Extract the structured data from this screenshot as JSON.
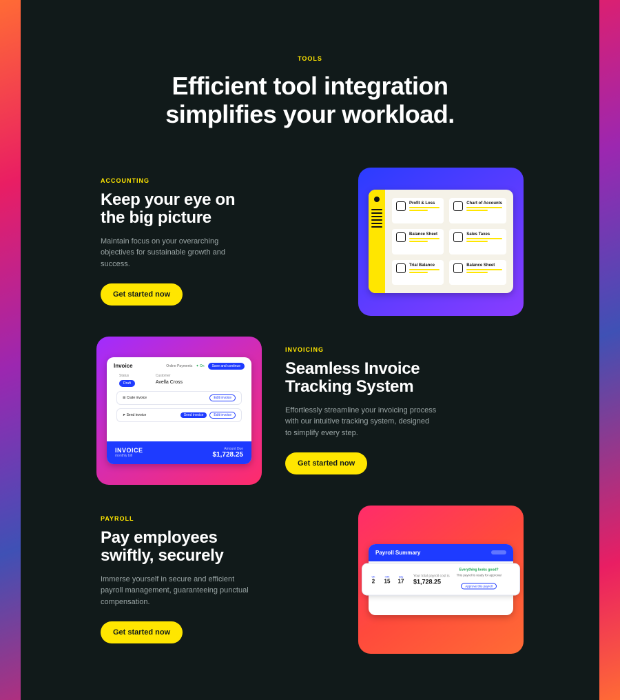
{
  "header": {
    "eyebrow": "TOOLS",
    "headline_line1": "Efficient tool integration",
    "headline_line2": "simplifies your workload."
  },
  "cta_label": "Get started now",
  "tool1": {
    "category": "ACCOUNTING",
    "title_line1": "Keep your eye on",
    "title_line2": "the big picture",
    "description": "Maintain focus on your overarching objectives for sustainable growth and success.",
    "cards": [
      "Profit & Loss",
      "Chart of Accounts",
      "Balance Sheet",
      "Sales Taxes",
      "Trial Balance",
      "Balance Sheet"
    ]
  },
  "tool2": {
    "category": "INVOICING",
    "title_line1": "Seamless Invoice",
    "title_line2": "Tracking System",
    "description": "Effortlessly streamline your invoicing process with our intuitive tracking system, designed to simplify every step.",
    "invoice": {
      "title": "Invoice",
      "online_payments": "Online Payments",
      "online_status": "✦ On",
      "save_btn": "Save and continue",
      "status_label": "Status",
      "status_value": "Draft",
      "customer_label": "Customer",
      "customer_value": "Avella Cross",
      "row1": "Crate invoice",
      "row2": "Send invoice",
      "edit_btn": "Edit invoice",
      "send_btn": "Send invoice",
      "banner_title": "INVOICE",
      "banner_sub": "monthly bill",
      "banner_amount_label": "Amount Due",
      "banner_amount": "$1,728.25"
    }
  },
  "tool3": {
    "category": "PAYROLL",
    "title_line1": "Pay employees",
    "title_line2": "swiftly, securely",
    "description": "Immerse yourself in secure and efficient payroll management, guaranteeing punctual compensation.",
    "payroll": {
      "header": "Payroll Summary",
      "date_labels": [
        "wk",
        "mth",
        "day"
      ],
      "date_values": [
        "2",
        "15",
        "17"
      ],
      "total_label": "Your total payroll cost is",
      "total_value": "$1,728.25",
      "approve_title": "Everything looks good?",
      "approve_sub": "This payroll is ready for approval",
      "approve_btn": "Approve this payroll"
    }
  }
}
